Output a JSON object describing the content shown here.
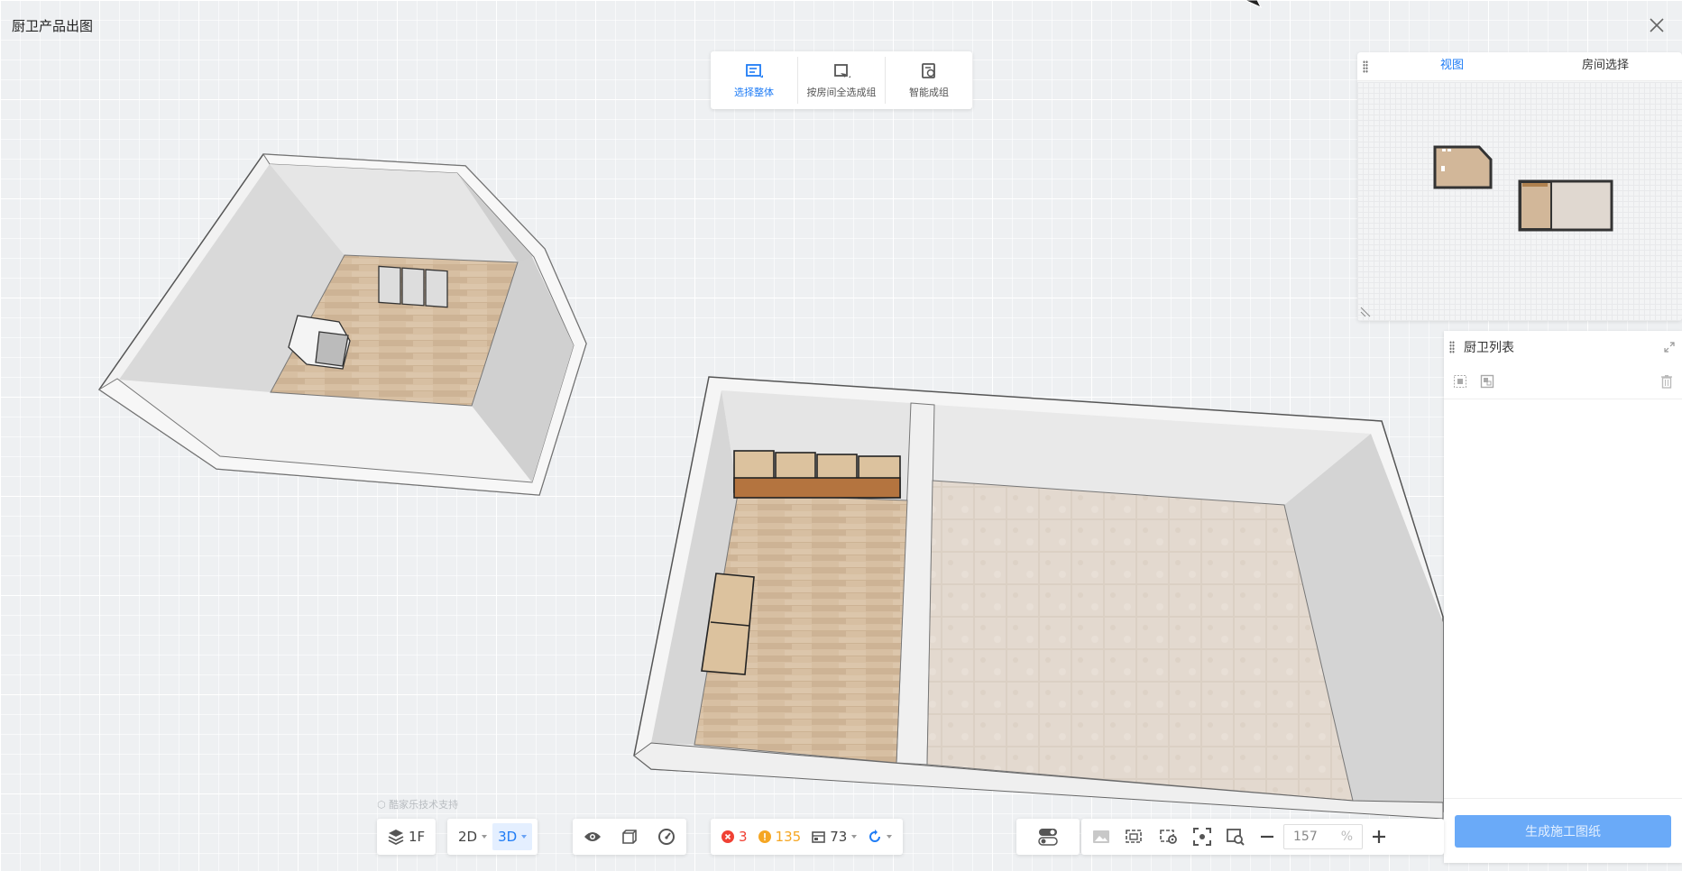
{
  "window": {
    "title": "厨卫产品出图"
  },
  "top_toolbar": {
    "items": [
      {
        "label": "选择整体",
        "icon": "select-whole-icon",
        "active": true
      },
      {
        "label": "按房间全选成组",
        "icon": "select-room-group-icon",
        "active": false
      },
      {
        "label": "智能成组",
        "icon": "smart-group-icon",
        "active": false
      }
    ]
  },
  "minimap": {
    "tabs": [
      {
        "label": "视图",
        "active": true
      },
      {
        "label": "房间选择",
        "active": false
      }
    ]
  },
  "kitchen_list": {
    "title": "厨卫列表",
    "generate_button": "生成施工图纸"
  },
  "bottom_toolbar": {
    "floor": "1F",
    "view_2d": "2D",
    "view_3d": "3D",
    "error_count": "3",
    "warning_count": "135",
    "item_count": "73",
    "zoom_value": "157",
    "zoom_unit": "%"
  },
  "watermark": "酷家乐技术支持",
  "colors": {
    "accent": "#1f7cf5",
    "error": "#f04134",
    "warning": "#f5a623",
    "button_disabled": "#6aaaf8"
  }
}
